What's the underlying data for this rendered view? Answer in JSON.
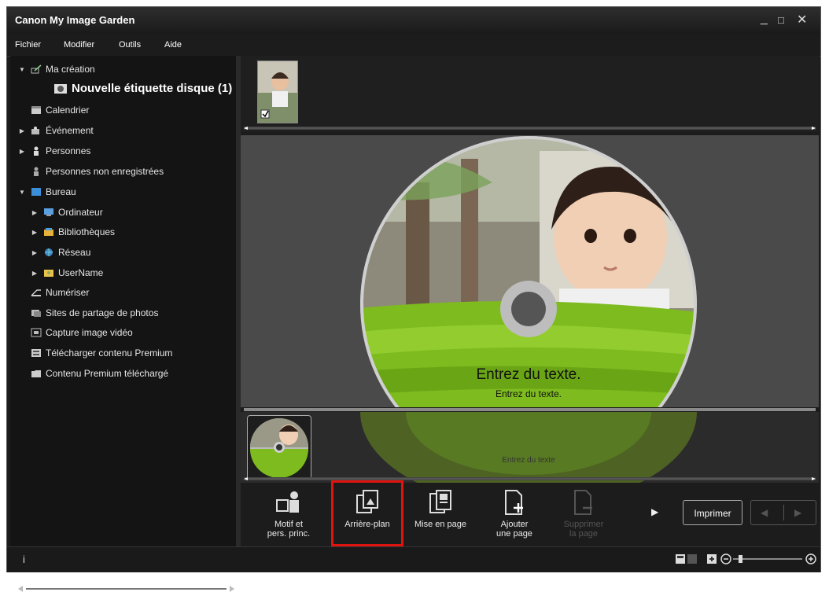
{
  "window": {
    "title": "Canon My Image Garden",
    "controls": [
      "_",
      "□",
      "✕"
    ]
  },
  "menu": [
    "Fichier",
    "Modifier",
    "Outils",
    "Aide"
  ],
  "sidebar": {
    "items": [
      {
        "label": "Ma création",
        "arrow": "▼",
        "icon": "creation-icon"
      },
      {
        "label": "Nouvelle étiquette disque (1)",
        "arrow": "",
        "icon": "disc-label-icon",
        "selected": true
      },
      {
        "label": "Calendrier",
        "arrow": "",
        "icon": "calendar-icon"
      },
      {
        "label": "Événement",
        "arrow": "▶",
        "icon": "event-icon"
      },
      {
        "label": "Personnes",
        "arrow": "▶",
        "icon": "people-icon"
      },
      {
        "label": "Personnes non enregistrées",
        "arrow": "",
        "icon": "unregistered-people-icon"
      },
      {
        "label": "Bureau",
        "arrow": "▼",
        "icon": "desktop-icon"
      },
      {
        "label": "Ordinateur",
        "arrow": "▶",
        "icon": "computer-icon"
      },
      {
        "label": "Bibliothèques",
        "arrow": "▶",
        "icon": "libraries-icon"
      },
      {
        "label": "Réseau",
        "arrow": "▶",
        "icon": "network-icon"
      },
      {
        "label": "UserName",
        "arrow": "▶",
        "icon": "user-folder-icon"
      },
      {
        "label": "Numériser",
        "arrow": "",
        "icon": "scan-icon"
      },
      {
        "label": "Sites de partage de photos",
        "arrow": "",
        "icon": "photo-sharing-icon"
      },
      {
        "label": "Capture image vidéo",
        "arrow": "",
        "icon": "video-capture-icon"
      },
      {
        "label": "Télécharger contenu Premium",
        "arrow": "",
        "icon": "download-premium-icon"
      },
      {
        "label": "Contenu Premium téléchargé",
        "arrow": "",
        "icon": "premium-folder-icon"
      }
    ]
  },
  "disc": {
    "text_main": "Entrez du texte.",
    "text_sub": "Entrez du texte.",
    "reflection_text": "Entrez du texte"
  },
  "toolbar": {
    "buttons": [
      {
        "label1": "Motif et",
        "label2": "pers. princ.",
        "icon": "theme-icon",
        "enabled": true
      },
      {
        "label1": "Arrière-plan",
        "label2": "",
        "icon": "background-icon",
        "enabled": true
      },
      {
        "label1": "Mise en page",
        "label2": "",
        "icon": "layout-icon",
        "enabled": true
      },
      {
        "label1": "Ajouter",
        "label2": "une page",
        "icon": "add-page-icon",
        "enabled": true
      },
      {
        "label1": "Supprimer",
        "label2": "la page",
        "icon": "delete-page-icon",
        "enabled": false
      }
    ],
    "more": "▶",
    "print": "Imprimer",
    "prev": "◀",
    "next": "▶"
  },
  "status": {
    "info": "i"
  },
  "colors": {
    "highlight": "#e0140f",
    "disc_green": "#7dbb1e"
  }
}
